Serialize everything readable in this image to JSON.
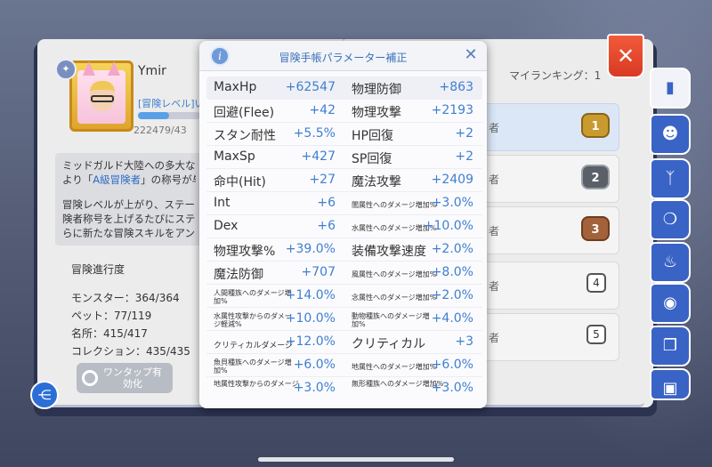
{
  "profile": {
    "name": "Ymir",
    "level_label": "[冒険レベル]い",
    "exp_text": "222479/43",
    "level_progress": 0.5
  },
  "description": {
    "line1": "ミッドガルド大陸への多大な",
    "line2_pre": "より「",
    "line2_highlight": "A級冒険者",
    "line2_post": "」の称号が与",
    "line3": "冒険レベルが上がり、ステータ",
    "line4": "険者称号を上げるたびにステ",
    "line5": "らに新たな冒険スキルをアン"
  },
  "progress": {
    "title": "冒険進行度",
    "monster": "モンスター：364/364",
    "pet": "ペット：77/119",
    "place": "名所：415/417",
    "collection": "コレクション：435/435"
  },
  "onetap": {
    "label_line1": "ワンタップ有",
    "label_line2": "効化"
  },
  "share": {
    "icon": "share-icon",
    "glyph": "⋲"
  },
  "ranking": {
    "my_ranking": "マイランキング：1",
    "rows": [
      {
        "suffix": "者",
        "rank": "1"
      },
      {
        "suffix": "者",
        "rank": "2"
      },
      {
        "suffix": "者",
        "rank": "3"
      },
      {
        "suffix": "者",
        "rank": "4"
      },
      {
        "suffix": "者",
        "rank": "5"
      }
    ]
  },
  "close": {
    "glyph": "✕"
  },
  "side_tabs": [
    {
      "icon": "book-icon",
      "glyph": "▮"
    },
    {
      "icon": "monster-face-icon",
      "glyph": "☻"
    },
    {
      "icon": "horns-icon",
      "glyph": "ᛉ"
    },
    {
      "icon": "pet-icon",
      "glyph": "❍"
    },
    {
      "icon": "chef-hat-icon",
      "glyph": "♨"
    },
    {
      "icon": "location-icon",
      "glyph": "◉"
    },
    {
      "icon": "open-book-icon",
      "glyph": "❐"
    },
    {
      "icon": "card-icon",
      "glyph": "▣"
    }
  ],
  "modal": {
    "title": "冒険手帳パラメーター補正",
    "info_glyph": "i",
    "close_glyph": "✕",
    "rows": [
      {
        "l1": "MaxHp",
        "v1": "+62547",
        "l2": "物理防御",
        "v2": "+863"
      },
      {
        "l1": "回避(Flee)",
        "v1": "+42",
        "l2": "物理攻撃",
        "v2": "+2193"
      },
      {
        "l1": "スタン耐性",
        "v1": "+5.5%",
        "l2": "HP回復",
        "v2": "+2"
      },
      {
        "l1": "MaxSp",
        "v1": "+427",
        "l2": "SP回復",
        "v2": "+2"
      },
      {
        "l1": "命中(Hit)",
        "v1": "+27",
        "l2": "魔法攻撃",
        "v2": "+2409"
      },
      {
        "l1": "Int",
        "v1": "+6",
        "l2": "闇属性へのダメージ増加%",
        "v2": "+3.0%"
      },
      {
        "l1": "Dex",
        "v1": "+6",
        "l2": "水属性へのダメージ増加%",
        "v2": "+10.0%"
      },
      {
        "l1": "物理攻撃%",
        "v1": "+39.0%",
        "l2": "装備攻撃速度",
        "v2": "+2.0%"
      },
      {
        "l1": "魔法防御",
        "v1": "+707",
        "l2": "風属性へのダメージ増加%",
        "v2": "+8.0%"
      },
      {
        "l1": "人間種族へのダメージ増加%",
        "v1": "+14.0%",
        "l2": "念属性へのダメージ増加%",
        "v2": "+2.0%"
      },
      {
        "l1": "水属性攻撃からのダメージ軽減%",
        "v1": "+10.0%",
        "l2": "動物種族へのダメージ増加%",
        "v2": "+4.0%"
      },
      {
        "l1": "クリティカルダメージ",
        "v1": "+12.0%",
        "l2": "クリティカル",
        "v2": "+3"
      },
      {
        "l1": "魚貝種族へのダメージ増加%",
        "v1": "+6.0%",
        "l2": "地属性へのダメージ増加%",
        "v2": "+6.0%"
      },
      {
        "l1": "地属性攻撃からのダメージ",
        "v1": "+3.0%",
        "l2": "無形種族へのダメージ増加%",
        "v2": "+3.0%"
      }
    ]
  }
}
